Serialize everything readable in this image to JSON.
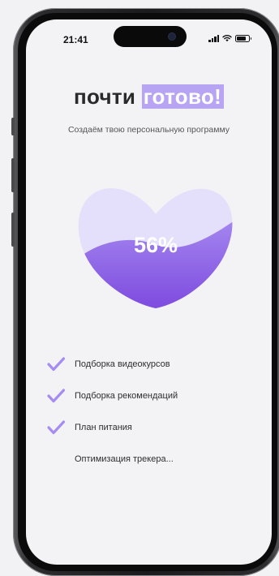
{
  "status_bar": {
    "time": "21:41",
    "battery_level": 0.8
  },
  "heading": {
    "prefix": "почти",
    "highlight": "готово!"
  },
  "subheading": "Создаём твою персональную программу",
  "progress": {
    "label": "56%",
    "value": 0.56
  },
  "checklist": [
    {
      "label": "Подборка видеокурсов",
      "done": true
    },
    {
      "label": "Подборка рекомендаций",
      "done": true
    },
    {
      "label": "План питания",
      "done": true
    },
    {
      "label": "Оптимизация трекера...",
      "done": false
    }
  ],
  "colors": {
    "accent": "#8b5fe3",
    "accent_light": "#e4dffa",
    "highlight_bg": "#b7a4f3",
    "check": "#a58cf0"
  }
}
